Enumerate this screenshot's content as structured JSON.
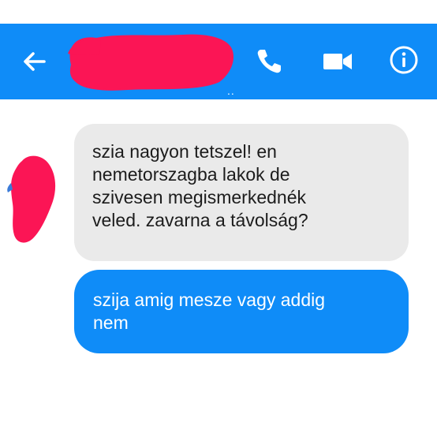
{
  "header": {
    "contact_name": "",
    "contact_name_suffix": "..",
    "back_icon": "arrow-left-icon",
    "call_icon": "phone-icon",
    "video_icon": "video-camera-icon",
    "info_icon": "info-circle-icon"
  },
  "messages": [
    {
      "direction": "incoming",
      "text": "szia nagyon tetszel! en\nnemetorszagba lakok de\nszivesen megismerkednék\nveled. zavarna a távolság?"
    },
    {
      "direction": "outgoing",
      "text": "szija amig mesze vagy addig\nnem"
    }
  ],
  "colors": {
    "header_bg": "#0f8cf8",
    "outgoing_bubble": "#0f8cf8",
    "incoming_bubble": "#eaeaea",
    "redaction": "#fb1555"
  }
}
